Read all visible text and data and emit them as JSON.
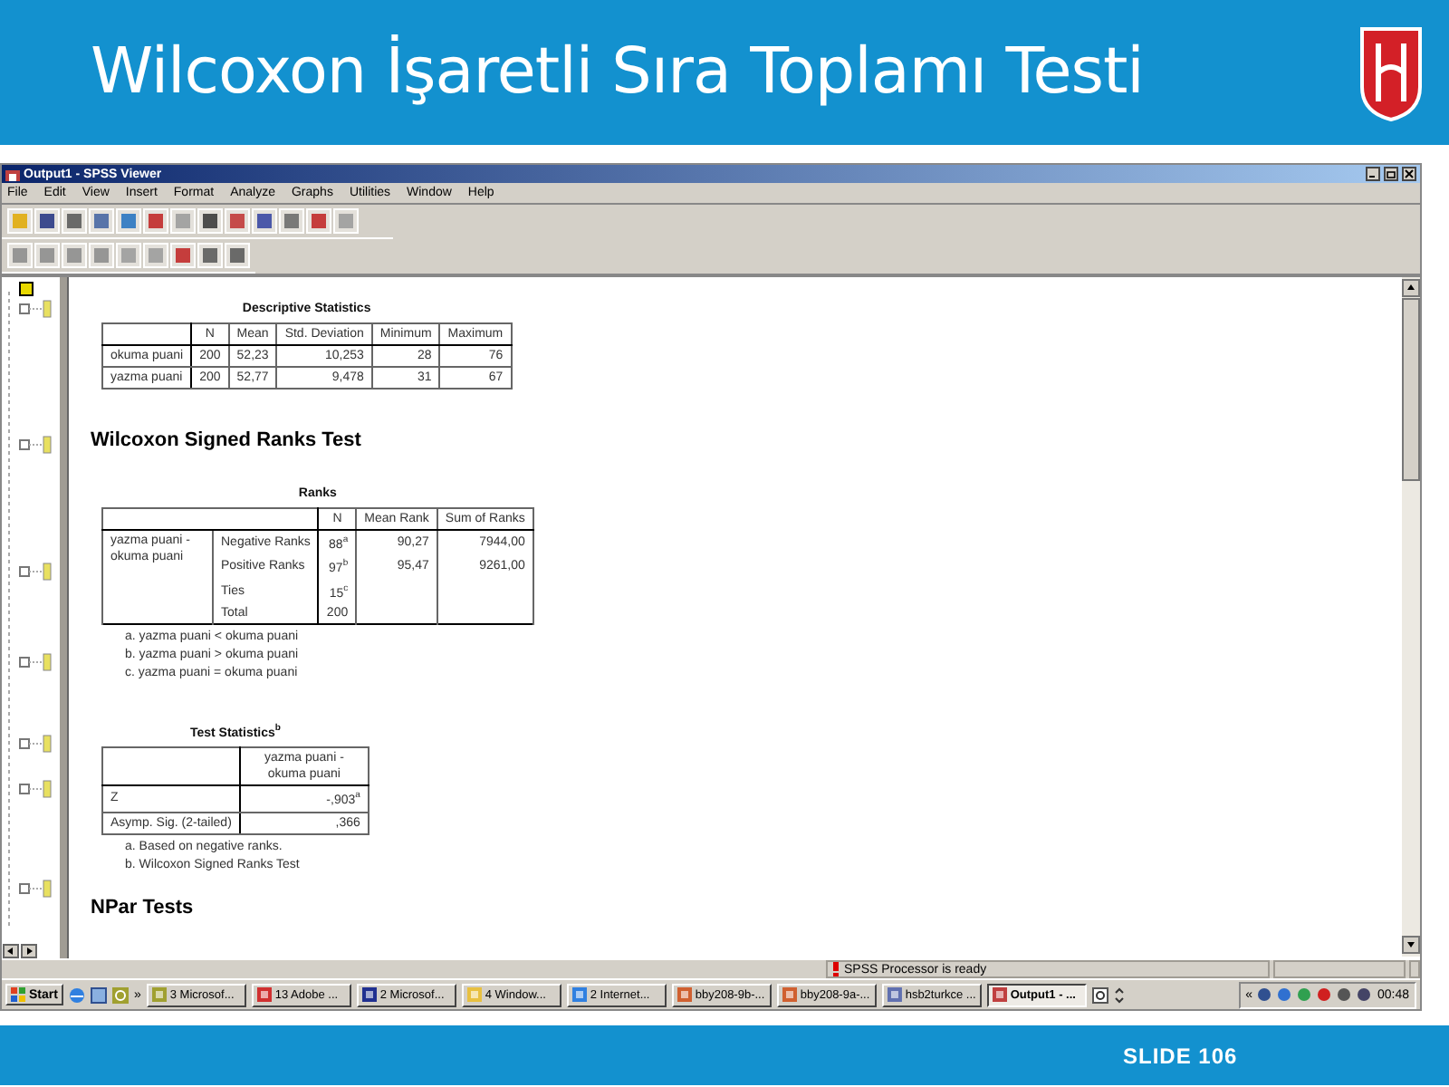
{
  "slide": {
    "title": "Wilcoxon İşaretli Sıra Toplamı Testi",
    "footer": "SLIDE 106"
  },
  "window": {
    "title": "Output1 - SPSS Viewer",
    "menu": [
      "File",
      "Edit",
      "View",
      "Insert",
      "Format",
      "Analyze",
      "Graphs",
      "Utilities",
      "Window",
      "Help"
    ]
  },
  "output": {
    "descriptives": {
      "title": "Descriptive Statistics",
      "columns": [
        "N",
        "Mean",
        "Std. Deviation",
        "Minimum",
        "Maximum"
      ],
      "rows": [
        {
          "label": "okuma puani",
          "cells": [
            "200",
            "52,23",
            "10,253",
            "28",
            "76"
          ]
        },
        {
          "label": "yazma puani",
          "cells": [
            "200",
            "52,77",
            "9,478",
            "31",
            "67"
          ]
        }
      ]
    },
    "heading": "Wilcoxon Signed Ranks Test",
    "ranks": {
      "title": "Ranks",
      "columns": [
        "N",
        "Mean Rank",
        "Sum of Ranks"
      ],
      "group": "yazma puani - okuma puani",
      "rows": [
        {
          "label": "Negative Ranks",
          "cells": [
            "88$^{a}$",
            "90,27",
            "7944,00"
          ]
        },
        {
          "label": "Positive Ranks",
          "cells": [
            "97$^{b}$",
            "95,47",
            "9261,00"
          ]
        },
        {
          "label": "Ties",
          "cells": [
            "15$^{c}$"
          ]
        },
        {
          "label": "Total",
          "cells": [
            "200"
          ]
        }
      ],
      "footnotes": [
        "a. yazma puani < okuma puani",
        "b. yazma puani > okuma puani",
        "c. yazma puani = okuma puani"
      ]
    },
    "test_statistics": {
      "title": "Test Statistics$^{b}$",
      "columns": [
        "yazma puani - okuma puani"
      ],
      "rows": [
        {
          "label": "Z",
          "cells": [
            "-,903$^{a}$"
          ]
        },
        {
          "label": "Asymp. Sig. (2-tailed)",
          "cells": [
            ",366"
          ]
        }
      ],
      "footnotes": [
        "a. Based on negative ranks.",
        "b. Wilcoxon Signed Ranks Test"
      ]
    },
    "next_heading": "NPar Tests"
  },
  "status_bar": {
    "message": "SPSS Processor  is ready"
  },
  "taskbar": {
    "start": "Start",
    "more": "»",
    "items": [
      {
        "label": "3 Microsof...",
        "selected": false
      },
      {
        "label": "13 Adobe ...",
        "selected": false
      },
      {
        "label": "2 Microsof...",
        "selected": false
      },
      {
        "label": "4 Window...",
        "selected": false
      },
      {
        "label": "2 Internet...",
        "selected": false
      },
      {
        "label": "bby208-9b-...",
        "selected": false
      },
      {
        "label": "bby208-9a-...",
        "selected": false
      },
      {
        "label": "hsb2turkce ...",
        "selected": false
      },
      {
        "label": "Output1 - ...",
        "selected": true
      }
    ],
    "tray_toggle": "«",
    "clock": "00:48"
  }
}
